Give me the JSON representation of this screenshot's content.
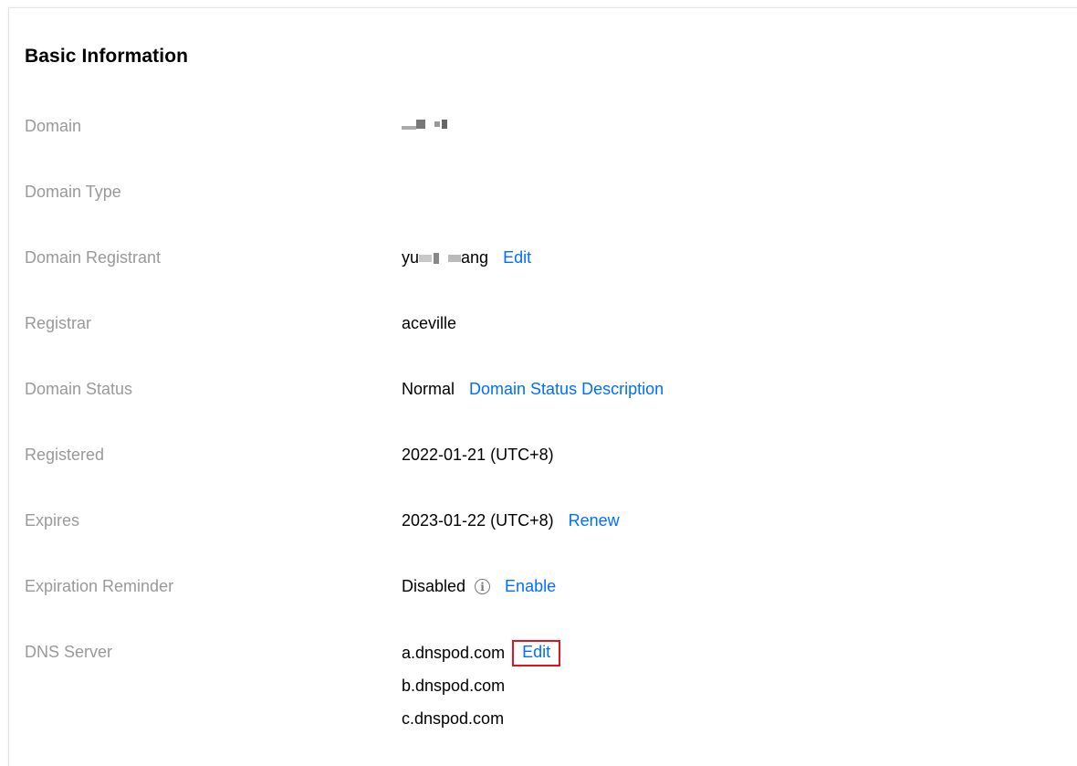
{
  "section": {
    "title": "Basic Information"
  },
  "fields": {
    "domain": {
      "label": "Domain"
    },
    "domain_type": {
      "label": "Domain Type"
    },
    "registrant": {
      "label": "Domain Registrant",
      "value_prefix": "yu",
      "value_suffix": "ang",
      "edit": "Edit"
    },
    "registrar": {
      "label": "Registrar",
      "value": "aceville"
    },
    "status": {
      "label": "Domain Status",
      "value": "Normal",
      "link": "Domain Status Description"
    },
    "registered": {
      "label": "Registered",
      "value": "2022-01-21 (UTC+8)"
    },
    "expires": {
      "label": "Expires",
      "value": "2023-01-22 (UTC+8)",
      "link": "Renew"
    },
    "reminder": {
      "label": "Expiration Reminder",
      "value": "Disabled",
      "info_icon": "info-icon",
      "link": "Enable"
    },
    "dns": {
      "label": "DNS Server",
      "servers": [
        "a.dnspod.com",
        "b.dnspod.com",
        "c.dnspod.com"
      ],
      "edit": "Edit"
    }
  },
  "colors": {
    "label": "#999999",
    "value": "#000000",
    "link": "#006eff",
    "highlight": "#e0141e"
  }
}
